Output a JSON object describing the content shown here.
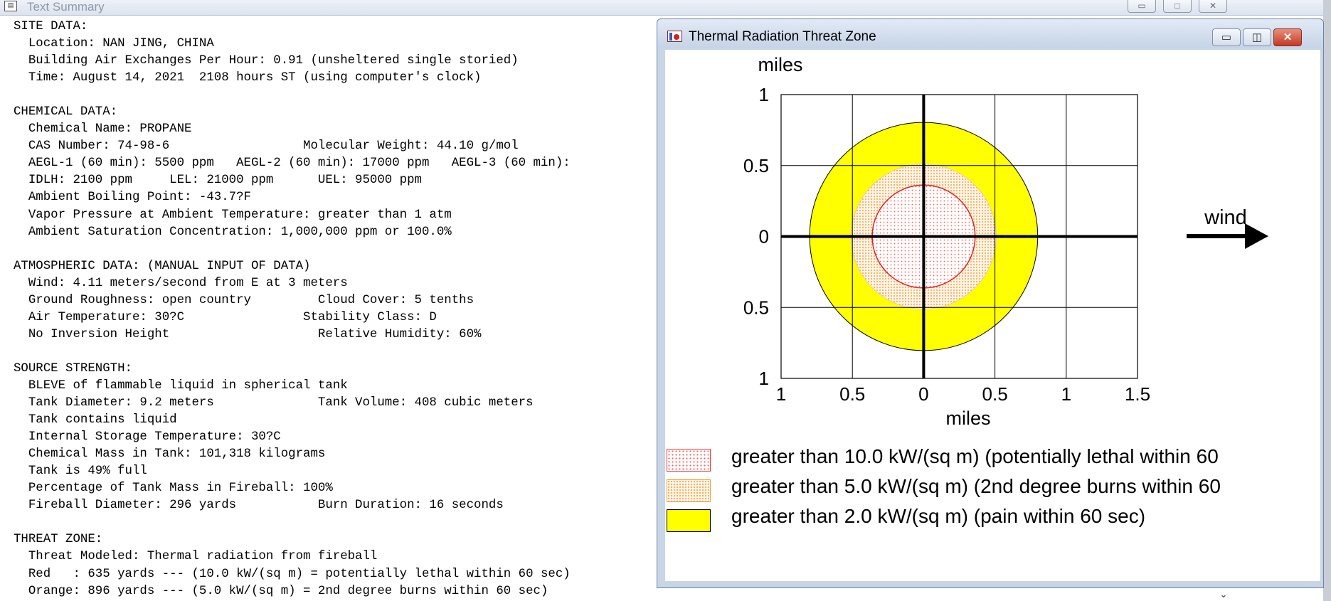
{
  "text_window": {
    "title": "Text Summary",
    "buttons": {
      "minimize": "▭",
      "maximize": "□",
      "close": "✕"
    },
    "lines": [
      "SITE DATA:",
      "  Location: NAN JING, CHINA",
      "  Building Air Exchanges Per Hour: 0.91 (unsheltered single storied)",
      "  Time: August 14, 2021  2108 hours ST (using computer's clock)",
      "",
      "CHEMICAL DATA:",
      "  Chemical Name: PROPANE",
      "  CAS Number: 74-98-6                  Molecular Weight: 44.10 g/mol",
      "  AEGL-1 (60 min): 5500 ppm   AEGL-2 (60 min): 17000 ppm   AEGL-3 (60 min):",
      "  IDLH: 2100 ppm     LEL: 21000 ppm      UEL: 95000 ppm",
      "  Ambient Boiling Point: -43.7?F",
      "  Vapor Pressure at Ambient Temperature: greater than 1 atm",
      "  Ambient Saturation Concentration: 1,000,000 ppm or 100.0%",
      "",
      "ATMOSPHERIC DATA: (MANUAL INPUT OF DATA)",
      "  Wind: 4.11 meters/second from E at 3 meters",
      "  Ground Roughness: open country         Cloud Cover: 5 tenths",
      "  Air Temperature: 30?C                Stability Class: D",
      "  No Inversion Height                    Relative Humidity: 60%",
      "",
      "SOURCE STRENGTH:",
      "  BLEVE of flammable liquid in spherical tank",
      "  Tank Diameter: 9.2 meters              Tank Volume: 408 cubic meters",
      "  Tank contains liquid",
      "  Internal Storage Temperature: 30?C",
      "  Chemical Mass in Tank: 101,318 kilograms",
      "  Tank is 49% full",
      "  Percentage of Tank Mass in Fireball: 100%",
      "  Fireball Diameter: 296 yards           Burn Duration: 16 seconds",
      "",
      "THREAT ZONE:",
      "  Threat Modeled: Thermal radiation from fireball",
      "  Red   : 635 yards --- (10.0 kW/(sq m) = potentially lethal within 60 sec)",
      "  Orange: 896 yards --- (5.0 kW/(sq m) = 2nd degree burns within 60 sec)"
    ],
    "scroll_arrow": "⌄"
  },
  "threat_window": {
    "title": "Thermal Radiation Threat Zone",
    "buttons": {
      "minimize": "▭",
      "maximize": "◫",
      "close": "✕"
    },
    "wind_label": "wind",
    "legend": [
      {
        "text": "greater than 10.0 kW/(sq m) (potentially lethal within 60",
        "color": "#ff2020"
      },
      {
        "text": "greater than 5.0 kW/(sq m) (2nd degree burns within 60",
        "color": "#f8a040"
      },
      {
        "text": "greater than 2.0 kW/(sq m) (pain within 60 sec)",
        "color": "#ffff00"
      }
    ]
  },
  "chart_data": {
    "type": "map",
    "xlabel": "miles",
    "ylabel": "miles",
    "xlim": [
      -1,
      1.5
    ],
    "ylim": [
      -1,
      1
    ],
    "x_ticks": [
      -1,
      -0.5,
      0,
      0.5,
      1,
      1.5
    ],
    "x_tick_labels": [
      "1",
      "0.5",
      "0",
      "0.5",
      "1",
      "1.5"
    ],
    "y_ticks": [
      1,
      0.5,
      0,
      -0.5,
      -1
    ],
    "y_tick_labels": [
      "1",
      "0.5",
      "0",
      "0.5",
      "1"
    ],
    "grid": true,
    "zones": [
      {
        "name": "greater than 2.0 kW/(sq m)",
        "radius_miles": 0.8,
        "fill": "#ffff00"
      },
      {
        "name": "greater than 5.0 kW/(sq m)",
        "radius_miles": 0.509,
        "fill": "#fde7c5"
      },
      {
        "name": "greater than 10.0 kW/(sq m)",
        "radius_miles": 0.361,
        "fill": "#fff0f0"
      }
    ]
  }
}
